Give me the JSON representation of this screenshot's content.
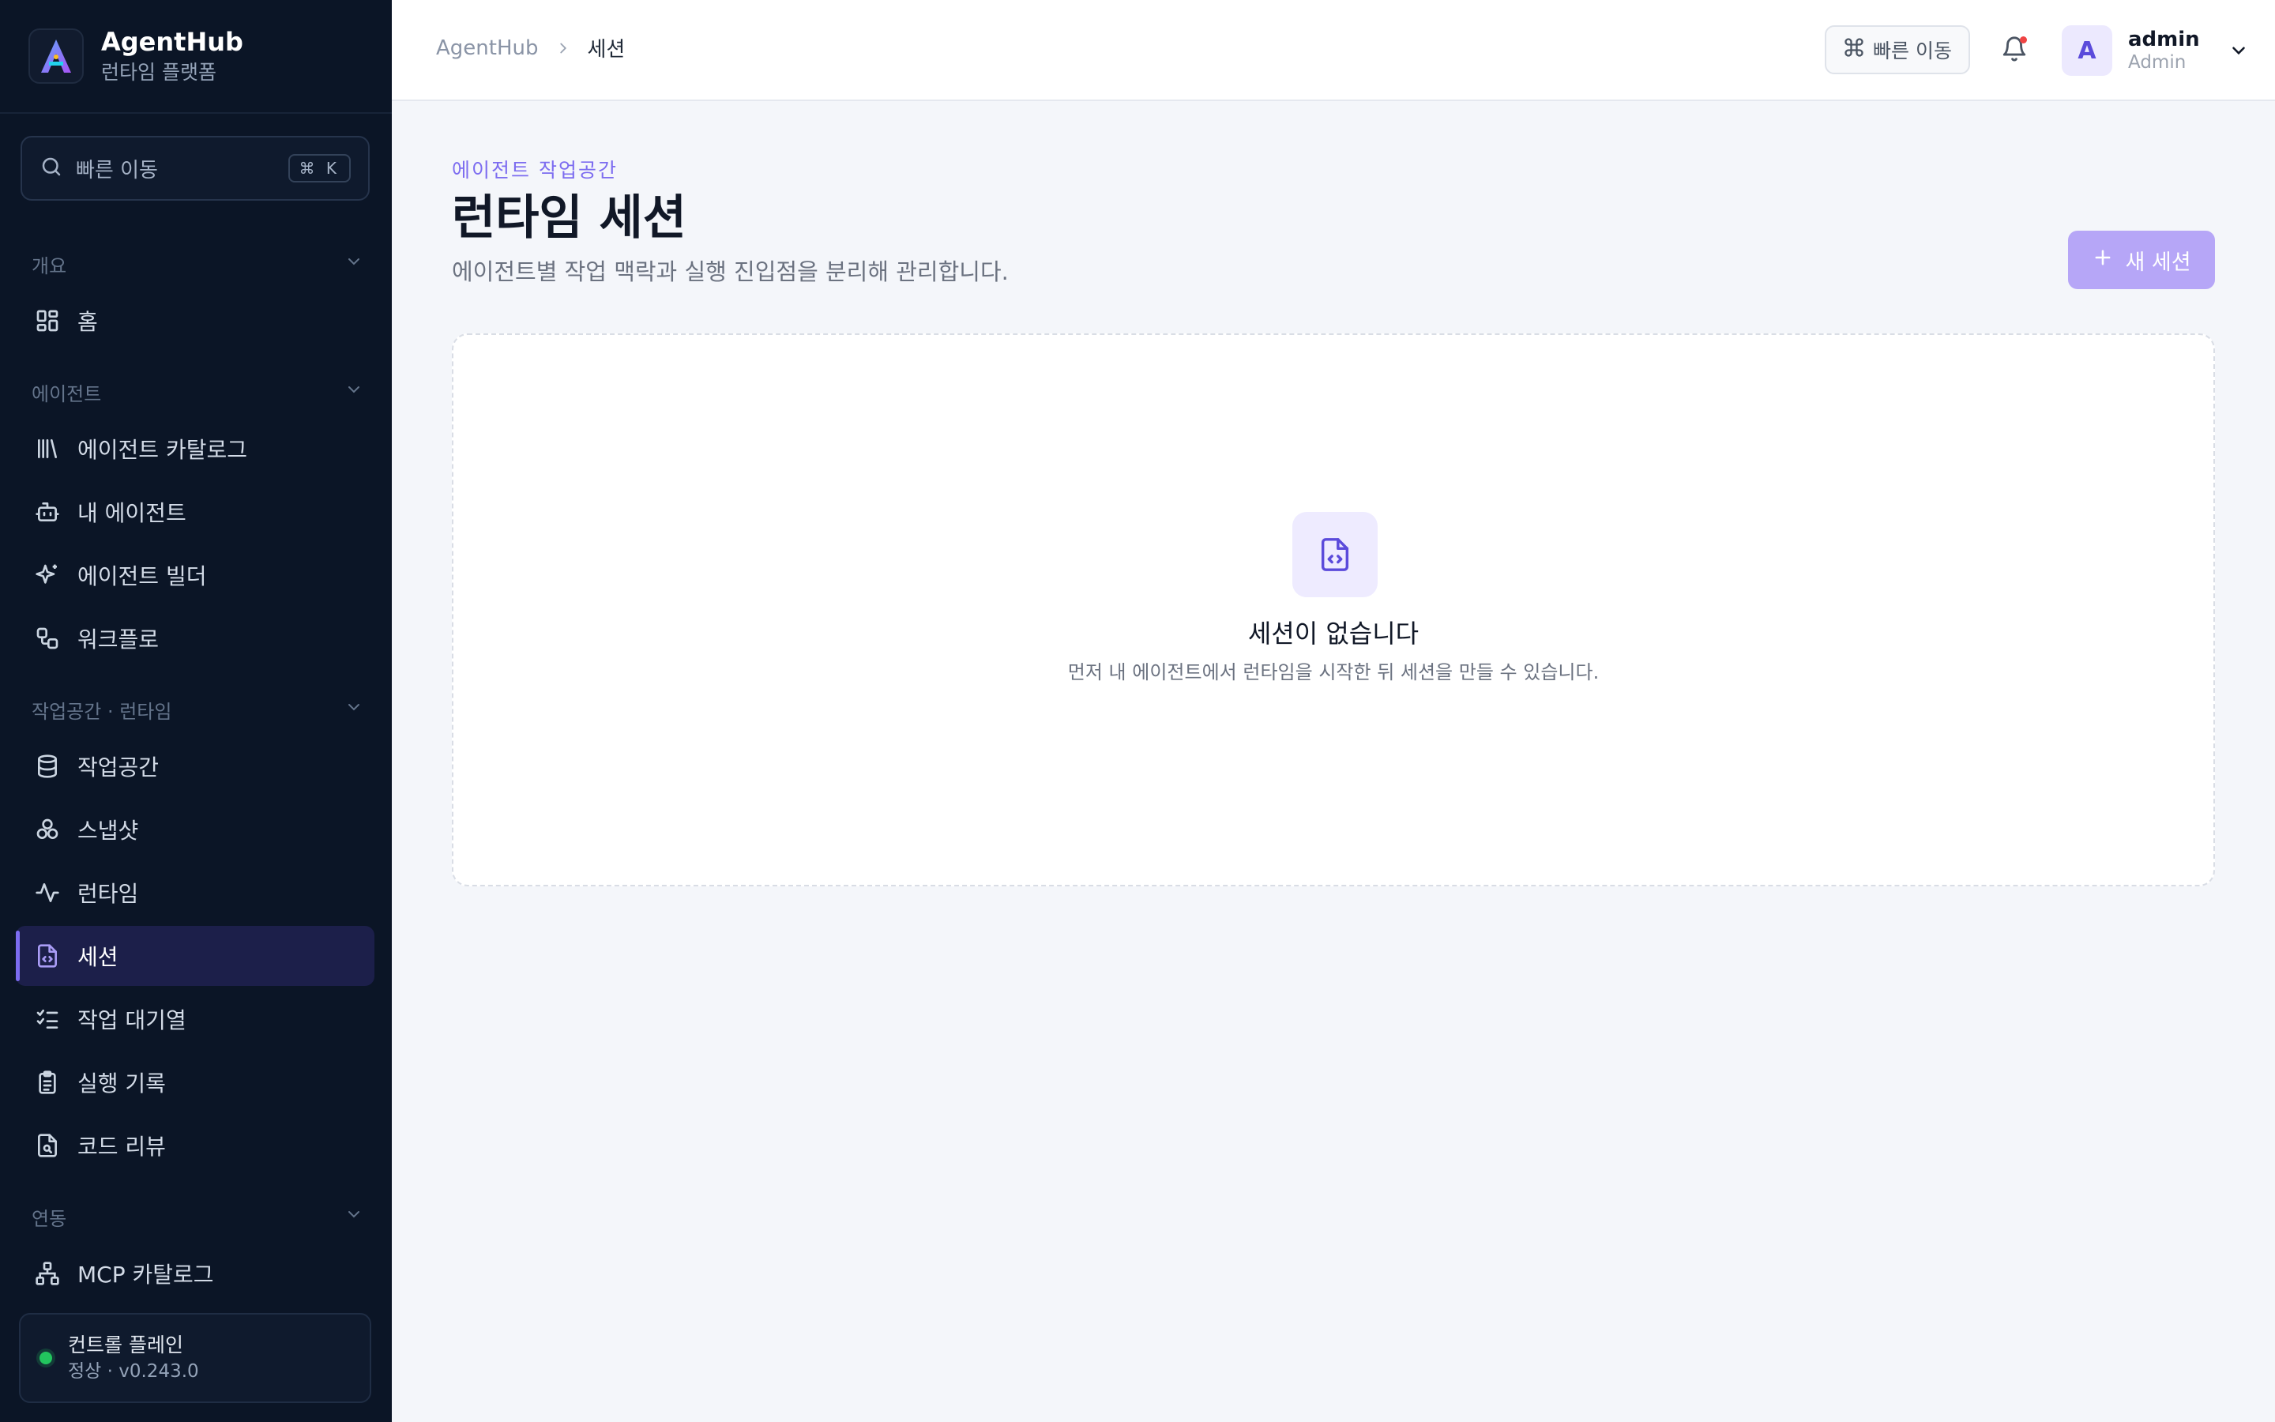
{
  "app": {
    "name": "AgentHub",
    "subtitle": "런타임 플랫폼"
  },
  "sidebar": {
    "search_label": "빠른 이동",
    "search_shortcut": "⌘ K",
    "sections": [
      {
        "label": "개요",
        "items": [
          {
            "label": "홈",
            "icon": "grid-icon"
          }
        ]
      },
      {
        "label": "에이전트",
        "items": [
          {
            "label": "에이전트 카탈로그",
            "icon": "library-icon"
          },
          {
            "label": "내 에이전트",
            "icon": "bot-icon"
          },
          {
            "label": "에이전트 빌더",
            "icon": "sparkles-icon"
          },
          {
            "label": "워크플로",
            "icon": "workflow-icon"
          }
        ]
      },
      {
        "label": "작업공간 · 런타임",
        "items": [
          {
            "label": "작업공간",
            "icon": "database-icon"
          },
          {
            "label": "스냅샷",
            "icon": "cluster-icon"
          },
          {
            "label": "런타임",
            "icon": "activity-icon"
          },
          {
            "label": "세션",
            "icon": "file-code-icon",
            "active": true
          },
          {
            "label": "작업 대기열",
            "icon": "list-checks-icon"
          },
          {
            "label": "실행 기록",
            "icon": "clipboard-icon"
          },
          {
            "label": "코드 리뷰",
            "icon": "file-search-icon"
          }
        ]
      },
      {
        "label": "연동",
        "items": [
          {
            "label": "MCP 카탈로그",
            "icon": "network-icon"
          }
        ]
      }
    ],
    "status": {
      "title": "컨트롤 플레인",
      "detail": "정상 · v0.243.0",
      "color": "#22c55e"
    }
  },
  "topbar": {
    "breadcrumb_root": "AgentHub",
    "breadcrumb_current": "세션",
    "quick_label": "빠른 이동",
    "user_initial": "A",
    "user_name": "admin",
    "user_role": "Admin"
  },
  "main": {
    "eyebrow": "에이전트 작업공간",
    "title": "런타임 세션",
    "subtitle": "에이전트별 작업 맥락과 실행 진입점을 분리해 관리합니다.",
    "new_button": "새 세션",
    "empty_title": "세션이 없습니다",
    "empty_subtitle": "먼저 내 에이전트에서 런타임을 시작한 뒤 세션을 만들 수 있습니다."
  },
  "colors": {
    "sidebar_bg": "#0b1526",
    "accent": "#7c6cf0",
    "active_bg": "#1c1f4a",
    "primary_button": "#b6a6f7"
  }
}
